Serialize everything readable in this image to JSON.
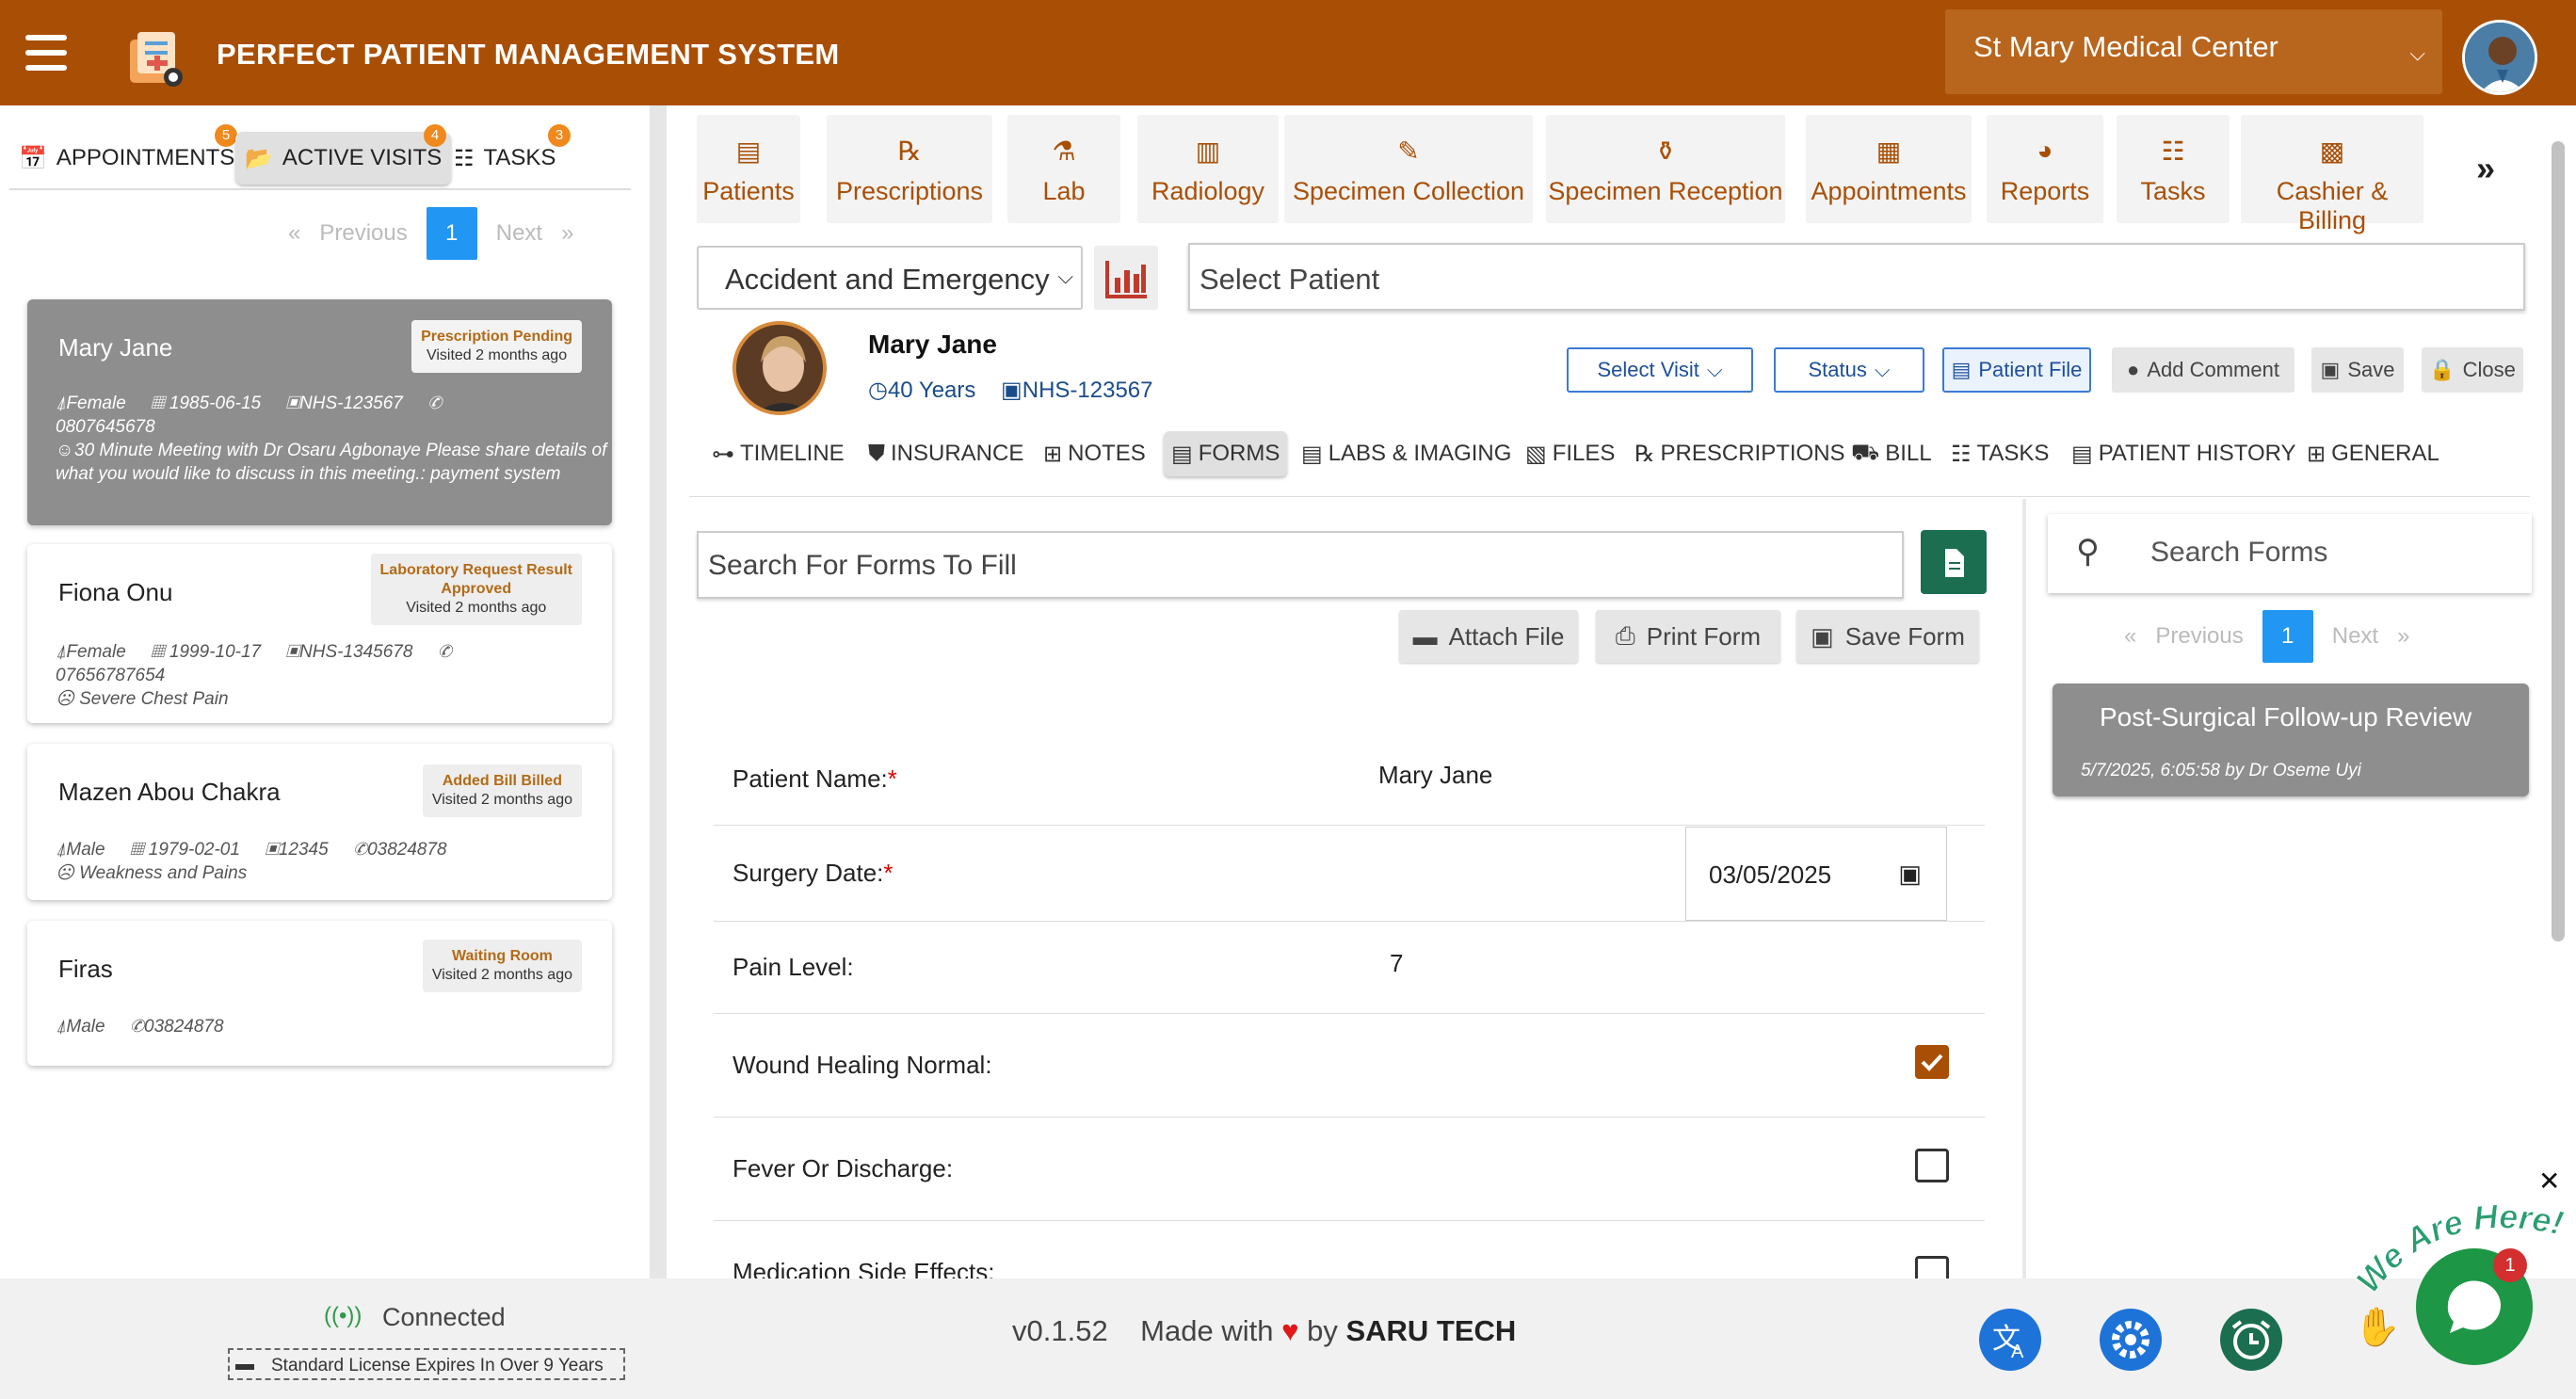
{
  "header": {
    "title": "PERFECT PATIENT MANAGEMENT SYSTEM",
    "center": "St Mary Medical Center"
  },
  "left": {
    "tabs": [
      {
        "label": "APPOINTMENTS",
        "badge": "5"
      },
      {
        "label": "ACTIVE VISITS",
        "badge": "4"
      },
      {
        "label": "TASKS",
        "badge": "3"
      }
    ],
    "pager": {
      "prev": "Previous",
      "page": "1",
      "next": "Next",
      "first": "«",
      "last": "»"
    },
    "visits": [
      {
        "name": "Mary Jane",
        "status": "Prescription Pending",
        "visited": "Visited 2 months ago",
        "gender": "Female",
        "dob": "1985-06-15",
        "nhs": "NHS-123567",
        "phone": "0807645678",
        "note": "30 Minute Meeting with Dr Osaru Agbonaye Please share details of what you would like to discuss in this meeting.: payment system"
      },
      {
        "name": "Fiona Onu",
        "status": "Laboratory Request Result",
        "status2": "Approved",
        "visited": "Visited 2 months ago",
        "gender": "Female",
        "dob": "1999-10-17",
        "nhs": "NHS-1345678",
        "phone": "07656787654",
        "note": "Severe Chest Pain"
      },
      {
        "name": "Mazen Abou Chakra",
        "status": "Added Bill Billed",
        "visited": "Visited 2 months ago",
        "gender": "Male",
        "dob": "1979-02-01",
        "nhs": "12345",
        "phone": "03824878",
        "note": "Weakness and Pains"
      },
      {
        "name": "Firas",
        "status": "Waiting Room",
        "visited": "Visited 2 months ago",
        "gender": "Male",
        "phone": "03824878"
      }
    ]
  },
  "modules": [
    "Patients",
    "Prescriptions",
    "Lab",
    "Radiology",
    "Specimen Collection",
    "Specimen Reception",
    "Appointments",
    "Reports",
    "Tasks",
    "Cashier & Billing"
  ],
  "more": "»",
  "department": "Accident and Emergency",
  "select_patient": "Select  Patient",
  "patient": {
    "name": "Mary Jane",
    "age": "40 Years",
    "nhs": "NHS-123567",
    "select_visit": "Select Visit",
    "status": "Status",
    "patient_file": "Patient File",
    "add_comment": "Add Comment",
    "save": "Save",
    "close": "Close"
  },
  "patient_tabs": [
    "TIMELINE",
    "INSURANCE",
    "NOTES",
    "FORMS",
    "LABS & IMAGING",
    "FILES",
    "PRESCRIPTIONS",
    "BILL",
    "TASKS",
    "PATIENT HISTORY",
    "GENERAL"
  ],
  "forms": {
    "search_placeholder": "Search For Forms To Fill",
    "attach": "Attach File",
    "print": "Print Form",
    "save": "Save Form",
    "fields": {
      "patient_name_label": "Patient Name:",
      "patient_name_value": "Mary Jane",
      "surgery_date_label": "Surgery Date:",
      "surgery_date_value": "03/05/2025",
      "pain_label": "Pain Level:",
      "pain_value": "7",
      "wound_label": "Wound Healing Normal:",
      "fever_label": "Fever Or Discharge:",
      "med_label": "Medication Side Effects:"
    },
    "wound_checked": true,
    "fever_checked": false,
    "required_mark": "*"
  },
  "form_list": {
    "search_placeholder": "Search Forms",
    "pager": {
      "prev": "Previous",
      "page": "1",
      "next": "Next",
      "first": "«",
      "last": "»"
    },
    "items": [
      {
        "title": "Post-Surgical Follow-up Review",
        "meta": "5/7/2025, 6:05:58 by Dr Oseme Uyi"
      }
    ]
  },
  "footer": {
    "connection": "Connected",
    "license": "Standard License Expires In Over 9 Years",
    "version": "v0.1.52",
    "made_with": "Made with",
    "by": "by",
    "company": "SARU TECH",
    "chat_badge": "1",
    "chat_tag": "We Are Here!",
    "close_chat": "✕"
  },
  "colors": {
    "brand": "#a94f05",
    "accent": "#2196f3",
    "green": "#1b6e4f"
  }
}
